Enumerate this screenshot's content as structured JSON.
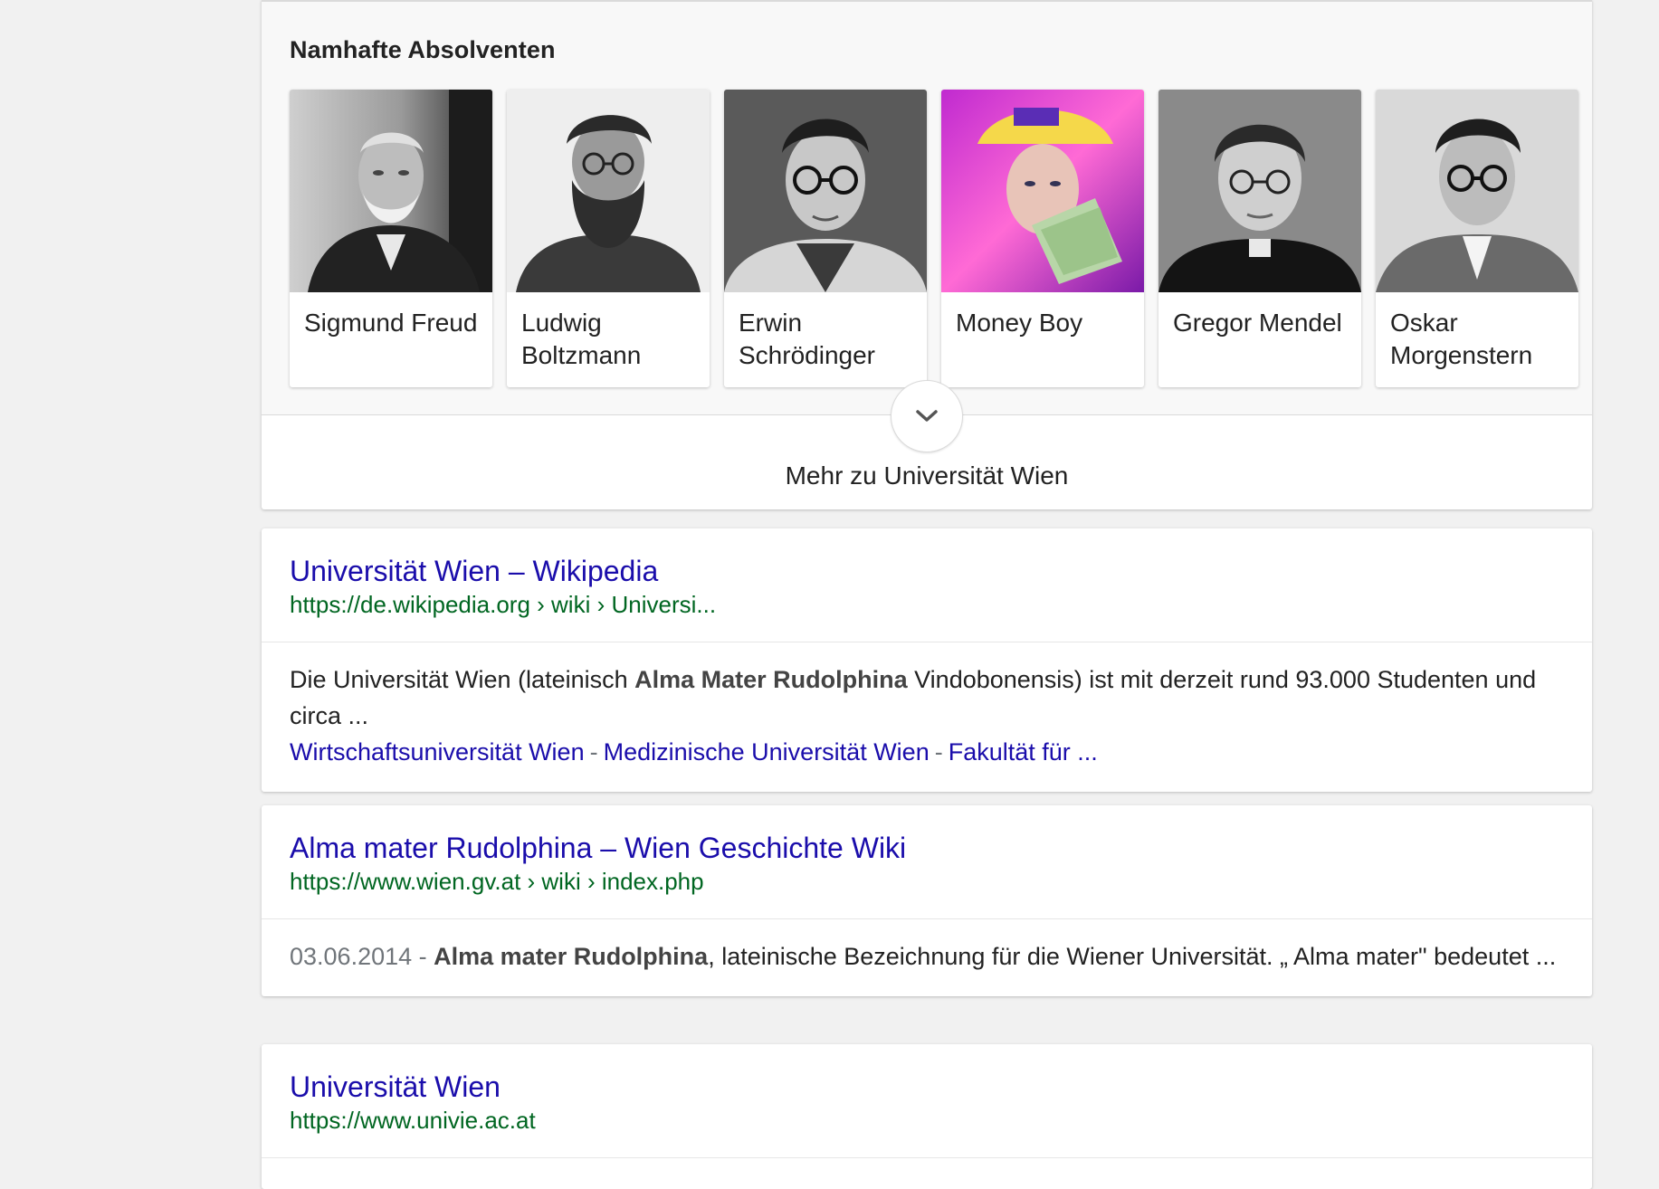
{
  "knowledge_panel": {
    "heading": "Namhafte Absolventen",
    "alumni": [
      {
        "name_line1": "Sigmund Freud",
        "name_line2": ""
      },
      {
        "name_line1": "Ludwig",
        "name_line2": "Boltzmann"
      },
      {
        "name_line1": "Erwin",
        "name_line2": "Schrödinger"
      },
      {
        "name_line1": "Money Boy",
        "name_line2": ""
      },
      {
        "name_line1": "Gregor Mendel",
        "name_line2": ""
      },
      {
        "name_line1": "Oskar",
        "name_line2": "Morgenstern"
      }
    ],
    "more_label": "Mehr zu Universität Wien"
  },
  "results": [
    {
      "title": "Universität Wien – Wikipedia",
      "url": "https://de.wikipedia.org › wiki › Universi...",
      "snippet_pre": "Die Universität Wien (lateinisch ",
      "snippet_bold": "Alma Mater Rudolphina",
      "snippet_post": " Vindobonensis) ist mit derzeit rund 93.000 Studenten und circa ...",
      "sitelinks": [
        "Wirtschaftsuniversität Wien",
        "Medizinische Universität Wien",
        "Fakultät für ..."
      ],
      "sitelink_sep": "-"
    },
    {
      "title": "Alma mater Rudolphina – Wien Geschichte Wiki",
      "url": "https://www.wien.gv.at › wiki › index.php",
      "date": "03.06.2014 -",
      "snippet_bold": "Alma mater Rudolphina",
      "snippet_post": ", lateinische Bezeichnung für die Wiener Universität. „ Alma mater\" bedeutet ..."
    },
    {
      "title": "Universität Wien",
      "url": "https://www.univie.ac.at"
    }
  ],
  "colors": {
    "link": "#1a0dab",
    "url": "#006621",
    "background": "#f1f1f1"
  },
  "icons": {
    "expand": "chevron-down-icon"
  }
}
